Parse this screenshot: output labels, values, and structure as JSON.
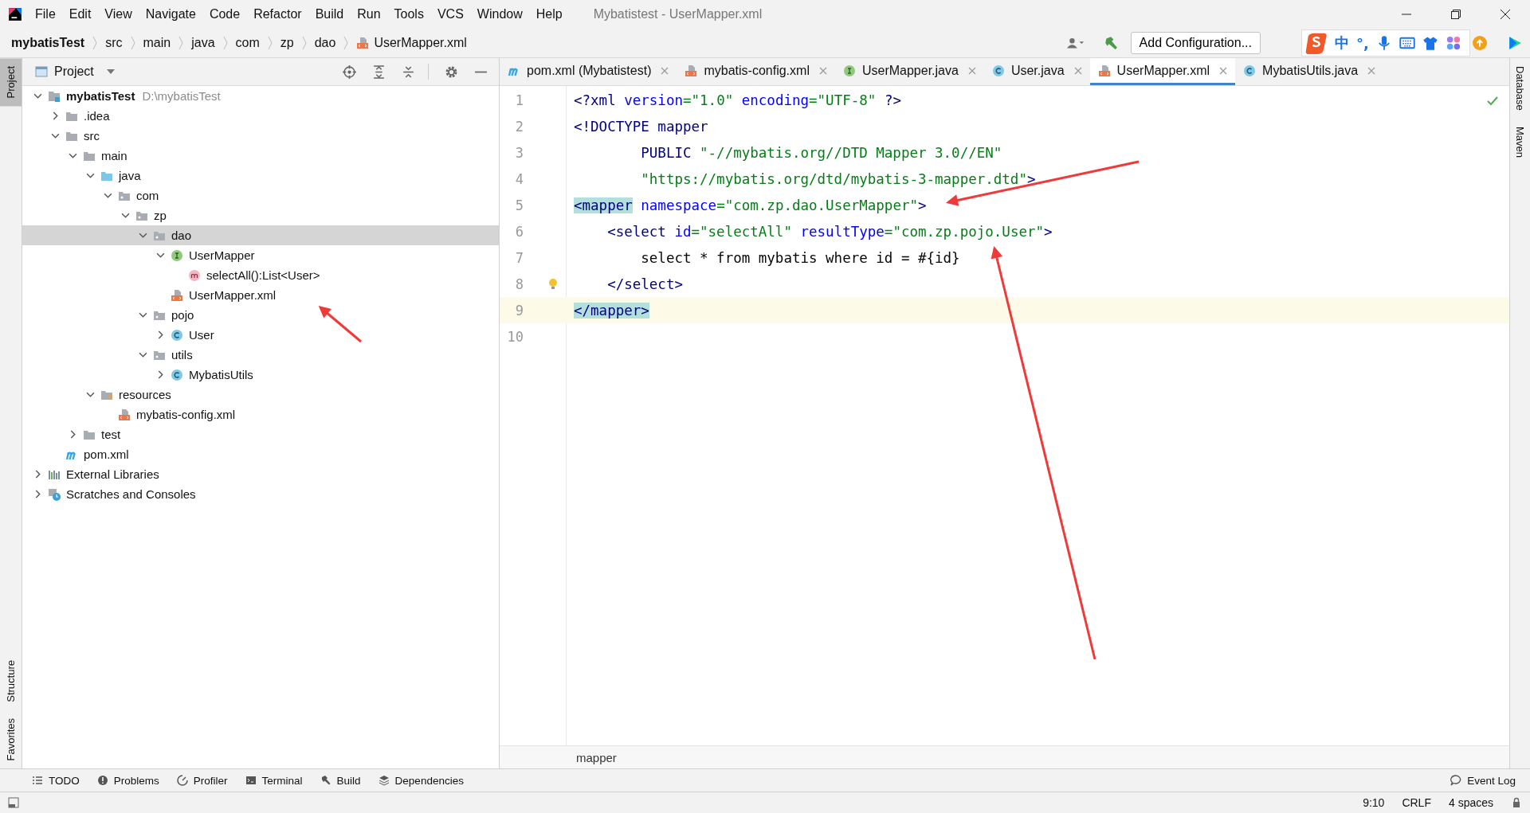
{
  "window": {
    "title": "Mybatistest - UserMapper.xml"
  },
  "menu": [
    "File",
    "Edit",
    "View",
    "Navigate",
    "Code",
    "Refactor",
    "Build",
    "Run",
    "Tools",
    "VCS",
    "Window",
    "Help"
  ],
  "breadcrumbs": [
    {
      "label": "mybatisTest",
      "kind": "project"
    },
    {
      "label": "src",
      "kind": "dir"
    },
    {
      "label": "main",
      "kind": "dir"
    },
    {
      "label": "java",
      "kind": "dir"
    },
    {
      "label": "com",
      "kind": "dir"
    },
    {
      "label": "zp",
      "kind": "dir"
    },
    {
      "label": "dao",
      "kind": "dir"
    },
    {
      "label": "UserMapper.xml",
      "kind": "xml"
    }
  ],
  "toolbar": {
    "run_config": "Add Configuration..."
  },
  "ime_bar": {
    "items": [
      {
        "kind": "logo"
      },
      {
        "kind": "text",
        "text": "中"
      },
      {
        "kind": "text",
        "text": "°,"
      },
      {
        "kind": "mic"
      },
      {
        "kind": "keyboard"
      },
      {
        "kind": "shirt"
      },
      {
        "kind": "apps"
      }
    ]
  },
  "left_strip": [
    {
      "label": "Project",
      "selected": true
    },
    {
      "label": "Structure",
      "selected": false
    },
    {
      "label": "Favorites",
      "selected": false
    }
  ],
  "right_strip": [
    {
      "label": "Database"
    },
    {
      "label": "Maven"
    }
  ],
  "project_panel": {
    "title": "Project",
    "tree": [
      {
        "label": "mybatisTest",
        "hint": "D:\\mybatisTest",
        "kind": "module",
        "expanded": true,
        "selected": false,
        "children": [
          {
            "label": ".idea",
            "kind": "folder",
            "expanded": false,
            "selected": false
          },
          {
            "label": "src",
            "kind": "folder",
            "expanded": true,
            "selected": false,
            "children": [
              {
                "label": "main",
                "kind": "folder",
                "expanded": true,
                "selected": false,
                "children": [
                  {
                    "label": "java",
                    "kind": "source",
                    "expanded": true,
                    "selected": false,
                    "children": [
                      {
                        "label": "com",
                        "kind": "package",
                        "expanded": true,
                        "selected": false,
                        "children": [
                          {
                            "label": "zp",
                            "kind": "package",
                            "expanded": true,
                            "selected": false,
                            "children": [
                              {
                                "label": "dao",
                                "kind": "package",
                                "expanded": true,
                                "selected": true,
                                "children": [
                                  {
                                    "label": "UserMapper",
                                    "kind": "interface",
                                    "expanded": true,
                                    "selected": false,
                                    "children": [
                                      {
                                        "label": "selectAll():List<User>",
                                        "kind": "method",
                                        "selected": false
                                      }
                                    ]
                                  },
                                  {
                                    "label": "UserMapper.xml",
                                    "kind": "xml",
                                    "selected": false
                                  }
                                ]
                              },
                              {
                                "label": "pojo",
                                "kind": "package",
                                "expanded": true,
                                "selected": false,
                                "children": [
                                  {
                                    "label": "User",
                                    "kind": "class",
                                    "expanded": false,
                                    "selected": false
                                  }
                                ]
                              },
                              {
                                "label": "utils",
                                "kind": "package",
                                "expanded": true,
                                "selected": false,
                                "children": [
                                  {
                                    "label": "MybatisUtils",
                                    "kind": "class",
                                    "expanded": false,
                                    "selected": false
                                  }
                                ]
                              }
                            ]
                          }
                        ]
                      }
                    ]
                  },
                  {
                    "label": "resources",
                    "kind": "resources",
                    "expanded": true,
                    "selected": false,
                    "children": [
                      {
                        "label": "mybatis-config.xml",
                        "kind": "xml",
                        "selected": false
                      }
                    ]
                  }
                ]
              },
              {
                "label": "test",
                "kind": "folder",
                "expanded": false,
                "selected": false
              }
            ]
          },
          {
            "label": "pom.xml",
            "kind": "maven",
            "selected": false
          }
        ]
      },
      {
        "label": "External Libraries",
        "kind": "libraries",
        "expanded": false,
        "selected": false
      },
      {
        "label": "Scratches and Consoles",
        "kind": "scratches",
        "expanded": false,
        "selected": false
      }
    ]
  },
  "tabs": [
    {
      "label": "pom.xml (Mybatistest)",
      "kind": "maven",
      "selected": false
    },
    {
      "label": "mybatis-config.xml",
      "kind": "xml",
      "selected": false
    },
    {
      "label": "UserMapper.java",
      "kind": "interface",
      "selected": false
    },
    {
      "label": "User.java",
      "kind": "class",
      "selected": false
    },
    {
      "label": "UserMapper.xml",
      "kind": "xml",
      "selected": true
    },
    {
      "label": "MybatisUtils.java",
      "kind": "class",
      "selected": false
    }
  ],
  "editor": {
    "lines": [
      {
        "number": "1",
        "current": false,
        "tokens": [
          {
            "text": "<?xml ",
            "kind": "tag"
          },
          {
            "text": "version",
            "kind": "attr"
          },
          {
            "text": "=\"1.0\" ",
            "kind": "str"
          },
          {
            "text": "encoding",
            "kind": "attr"
          },
          {
            "text": "=\"UTF-8\" ",
            "kind": "str"
          },
          {
            "text": "?>",
            "kind": "tag"
          }
        ]
      },
      {
        "number": "2",
        "current": false,
        "tokens": [
          {
            "text": "<!DOCTYPE mapper",
            "kind": "tag"
          }
        ]
      },
      {
        "number": "3",
        "current": false,
        "tokens": [
          {
            "text": "        PUBLIC ",
            "kind": "tag"
          },
          {
            "text": "\"-//mybatis.org//DTD Mapper 3.0//EN\"",
            "kind": "str"
          }
        ]
      },
      {
        "number": "4",
        "current": false,
        "tokens": [
          {
            "text": "        \"https://mybatis.org/dtd/mybatis-3-mapper.dtd\"",
            "kind": "str"
          },
          {
            "text": ">",
            "kind": "tag"
          }
        ]
      },
      {
        "number": "5",
        "current": false,
        "tokens": [
          {
            "text": "<mapper",
            "kind": "match"
          },
          {
            "text": " namespace",
            "kind": "attr"
          },
          {
            "text": "=\"com.zp.dao.UserMapper\"",
            "kind": "str"
          },
          {
            "text": ">",
            "kind": "tag"
          }
        ]
      },
      {
        "number": "6",
        "current": false,
        "tokens": [
          {
            "text": "    <select ",
            "kind": "tag"
          },
          {
            "text": "id",
            "kind": "attr"
          },
          {
            "text": "=\"selectAll\" ",
            "kind": "str"
          },
          {
            "text": "resultType",
            "kind": "attr"
          },
          {
            "text": "=\"com.zp.pojo.User\"",
            "kind": "str"
          },
          {
            "text": ">",
            "kind": "tag"
          }
        ]
      },
      {
        "number": "7",
        "current": false,
        "tokens": [
          {
            "text": "        select * from mybatis where id = #{id}",
            "kind": "plain"
          }
        ]
      },
      {
        "number": "8",
        "current": false,
        "bulb": true,
        "tokens": [
          {
            "text": "    </select>",
            "kind": "tag"
          }
        ]
      },
      {
        "number": "9",
        "current": true,
        "tokens": [
          {
            "text": "</mapper>",
            "kind": "match"
          }
        ]
      },
      {
        "number": "10",
        "current": false
      }
    ],
    "breadcrumb": "mapper"
  },
  "tool_windows": [
    {
      "label": "TODO",
      "kind": "list"
    },
    {
      "label": "Problems",
      "kind": "problems"
    },
    {
      "label": "Profiler",
      "kind": "profiler"
    },
    {
      "label": "Terminal",
      "kind": "terminal"
    },
    {
      "label": "Build",
      "kind": "hammer"
    },
    {
      "label": "Dependencies",
      "kind": "layers"
    }
  ],
  "event_log": "Event Log",
  "status_bar": [
    "9:10",
    "CRLF",
    "4 spaces"
  ]
}
